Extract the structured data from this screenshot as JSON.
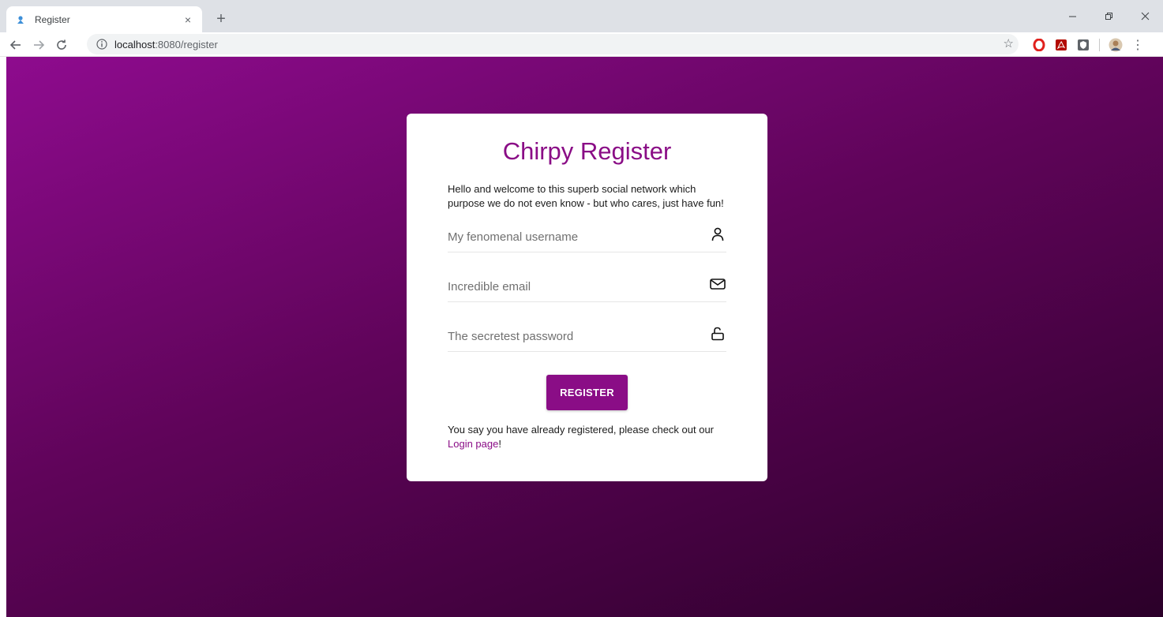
{
  "browser": {
    "tab": {
      "title": "Register",
      "close_glyph": "×"
    },
    "new_tab_glyph": "+",
    "window_controls": {
      "minimize": "–",
      "restore": "❐",
      "close": "✕"
    },
    "nav": {
      "back": "←",
      "forward": "→",
      "reload": "C"
    },
    "address": {
      "host": "localhost",
      "path": ":8080/register"
    },
    "bookmark_glyph": "☆",
    "menu_glyph": "⋮"
  },
  "page": {
    "title": "Chirpy Register",
    "intro": "Hello and welcome to this superb social network which purpose we do not even know - but who cares, just have fun!",
    "fields": {
      "username_placeholder": "My fenomenal username",
      "email_placeholder": "Incredible email",
      "password_placeholder": "The secretest password"
    },
    "register_label": "REGISTER",
    "footer_prefix": "You say you have already registered, please check out our ",
    "login_link": "Login page",
    "footer_suffix": "!"
  },
  "colors": {
    "brand": "#8a0d86",
    "background_start": "#8e0b8e",
    "background_end": "#2b0029"
  },
  "icons": {
    "username": "user-icon",
    "email": "mail-icon",
    "password": "unlock-icon"
  }
}
